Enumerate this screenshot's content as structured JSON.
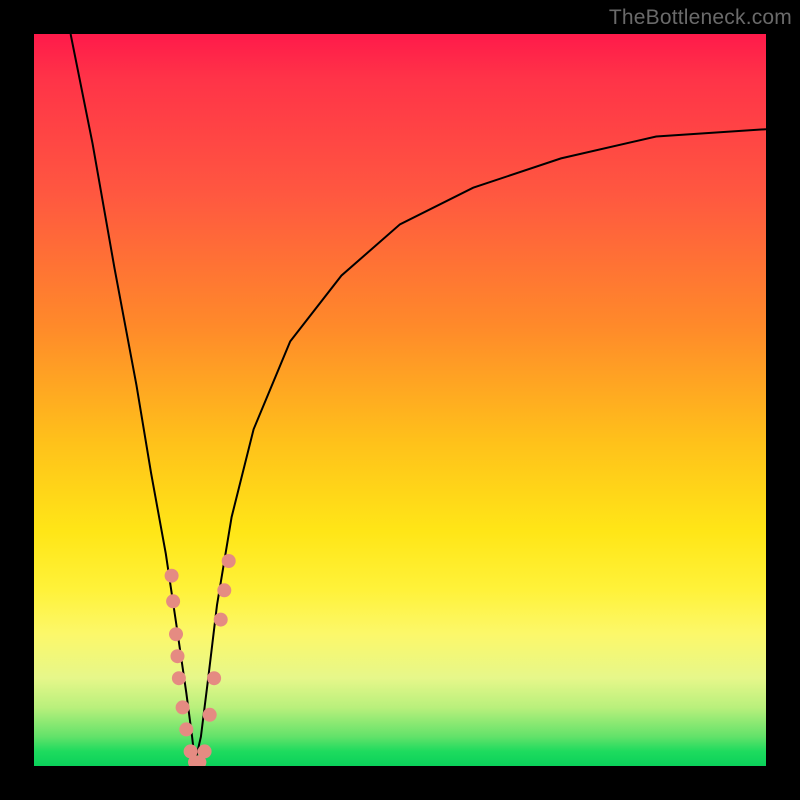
{
  "watermark": "TheBottleneck.com",
  "colors": {
    "background_frame": "#000000",
    "gradient_top": "#ff1a4a",
    "gradient_mid1": "#ff8a2a",
    "gradient_mid2": "#ffe617",
    "gradient_bottom": "#0ad15a",
    "curve_stroke": "#000000",
    "marker_fill": "#e58b82"
  },
  "chart_data": {
    "type": "line",
    "title": "",
    "xlabel": "",
    "ylabel": "",
    "xlim": [
      0,
      100
    ],
    "ylim": [
      0,
      100
    ],
    "grid": false,
    "legend": false,
    "series": [
      {
        "name": "bottleneck-curve",
        "description": "V-shaped curve; minimum (best fit) near x≈22; both arms rise toward the top edges",
        "x": [
          5,
          8,
          11,
          14,
          16,
          18,
          19.5,
          20.8,
          21.6,
          22.0,
          22.8,
          23.8,
          25,
          27,
          30,
          35,
          42,
          50,
          60,
          72,
          85,
          100
        ],
        "y": [
          100,
          85,
          68,
          52,
          40,
          29,
          19,
          10,
          4,
          0.5,
          4,
          12,
          22,
          34,
          46,
          58,
          67,
          74,
          79,
          83,
          86,
          87
        ]
      }
    ],
    "markers": {
      "name": "highlighted-points",
      "description": "Salmon-colored points clustered around the curve minimum on both arms",
      "points": [
        {
          "x": 18.8,
          "y": 26
        },
        {
          "x": 19.0,
          "y": 22.5
        },
        {
          "x": 19.4,
          "y": 18
        },
        {
          "x": 19.6,
          "y": 15
        },
        {
          "x": 19.8,
          "y": 12
        },
        {
          "x": 20.3,
          "y": 8
        },
        {
          "x": 20.8,
          "y": 5
        },
        {
          "x": 21.4,
          "y": 2
        },
        {
          "x": 22.0,
          "y": 0.5
        },
        {
          "x": 22.6,
          "y": 0.5
        },
        {
          "x": 23.3,
          "y": 2
        },
        {
          "x": 24.0,
          "y": 7
        },
        {
          "x": 24.6,
          "y": 12
        },
        {
          "x": 25.5,
          "y": 20
        },
        {
          "x": 26.0,
          "y": 24
        },
        {
          "x": 26.6,
          "y": 28
        }
      ],
      "radius_px": 7
    }
  }
}
